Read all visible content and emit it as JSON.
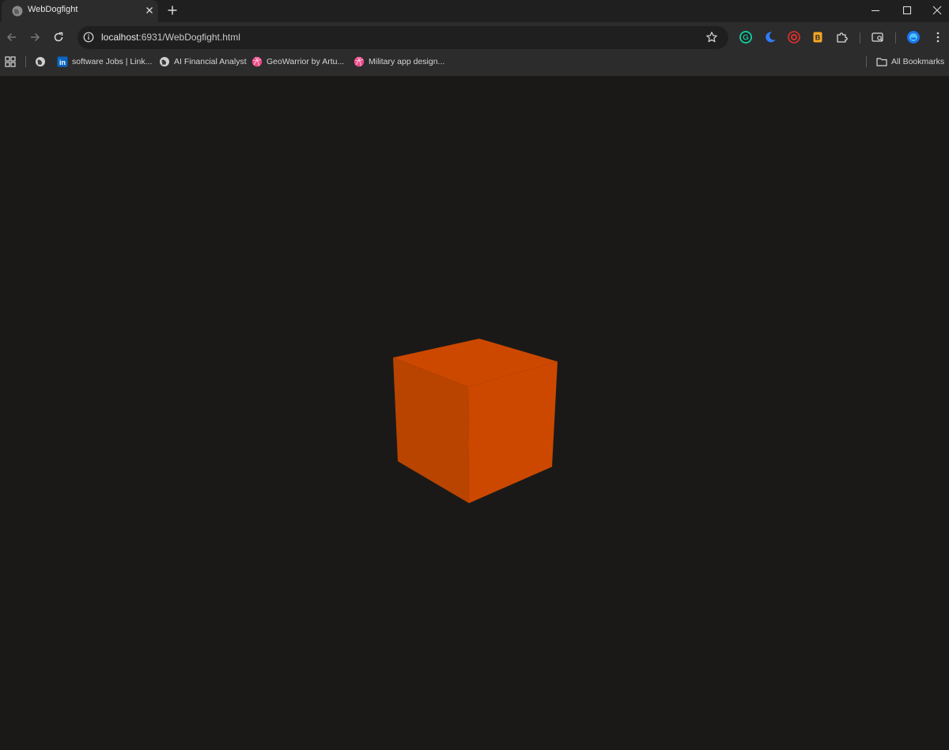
{
  "browser": {
    "tab": {
      "title": "WebDogfight",
      "favicon": "globe-icon"
    },
    "window_controls": [
      "minimize-icon",
      "maximize-icon",
      "close-icon"
    ],
    "address_bar": {
      "host": "localhost",
      "path": ":6931/WebDogfight.html"
    },
    "extensions": [
      "grammarly-icon",
      "dark-mode-moon-icon",
      "blocker-icon",
      "bookmark-b-icon",
      "puzzle-icon",
      "tab-search-icon",
      "profile-icon",
      "menu-kebab-icon"
    ],
    "bookmarks": [
      {
        "label": "software Jobs | Link...",
        "icon": "linkedin-icon"
      },
      {
        "label": "AI Financial Analyst",
        "icon": "globe-icon"
      },
      {
        "label": "GeoWarrior by Artu...",
        "icon": "dribbble-icon"
      },
      {
        "label": "Military app design...",
        "icon": "dribbble-icon"
      }
    ],
    "all_bookmarks_label": "All Bookmarks"
  },
  "scene": {
    "object": "cube",
    "colors": {
      "top": "#cc4800",
      "left": "#b84400",
      "right": "#cc4800",
      "background": "#1a1918"
    }
  }
}
